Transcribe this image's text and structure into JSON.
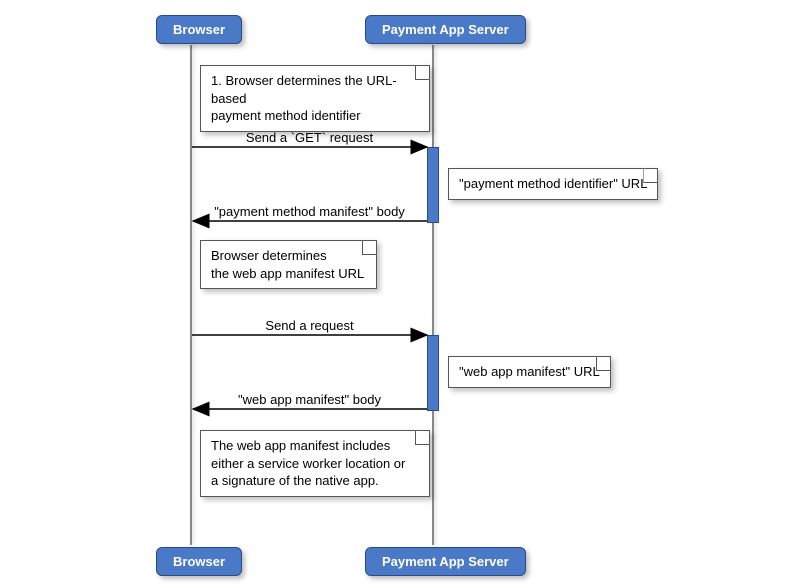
{
  "participants": {
    "browser": "Browser",
    "server": "Payment App Server"
  },
  "notes": {
    "n1": "1. Browser determines the URL-based\npayment method identifier",
    "n2": "\"payment method identifier\" URL",
    "n3": "Browser determines\nthe web app manifest URL",
    "n4": "\"web app manifest\" URL",
    "n5": "The web app manifest includes\neither a service worker location or\na signature of the native app."
  },
  "messages": {
    "m1": "Send a `GET` request",
    "m2": "\"payment method manifest\" body",
    "m3": "Send a request",
    "m4": "\"web app manifest\" body"
  },
  "chart_data": {
    "type": "sequence-diagram",
    "participants": [
      "Browser",
      "Payment App Server"
    ],
    "events": [
      {
        "kind": "note",
        "over": "Browser",
        "text": "1. Browser determines the URL-based payment method identifier"
      },
      {
        "kind": "message",
        "from": "Browser",
        "to": "Payment App Server",
        "label": "Send a `GET` request"
      },
      {
        "kind": "note",
        "over": "Payment App Server",
        "text": "\"payment method identifier\" URL"
      },
      {
        "kind": "message",
        "from": "Payment App Server",
        "to": "Browser",
        "label": "\"payment method manifest\" body"
      },
      {
        "kind": "note",
        "over": "Browser",
        "text": "Browser determines the web app manifest URL"
      },
      {
        "kind": "message",
        "from": "Browser",
        "to": "Payment App Server",
        "label": "Send a request"
      },
      {
        "kind": "note",
        "over": "Payment App Server",
        "text": "\"web app manifest\" URL"
      },
      {
        "kind": "message",
        "from": "Payment App Server",
        "to": "Browser",
        "label": "\"web app manifest\" body"
      },
      {
        "kind": "note",
        "over": "Browser",
        "text": "The web app manifest includes either a service worker location or a signature of the native app."
      }
    ]
  }
}
